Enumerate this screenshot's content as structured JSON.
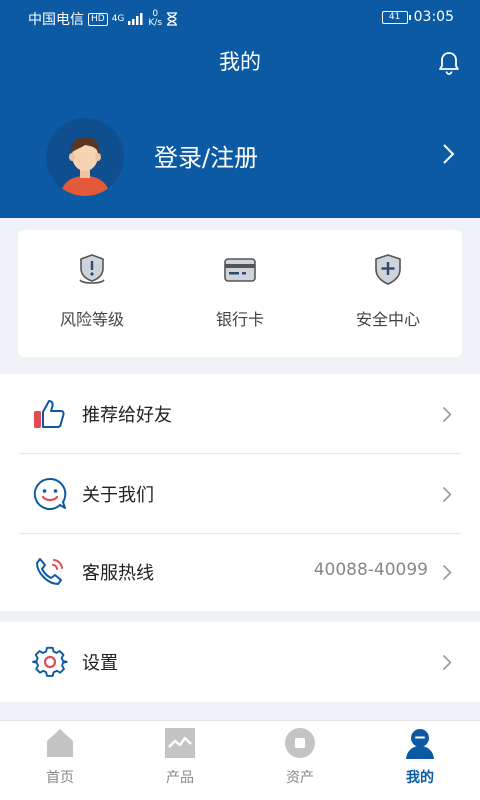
{
  "status_bar": {
    "carrier": "中国电信",
    "hd": "HD",
    "signal": "4G",
    "speed_value": "0",
    "speed_unit": "K/s",
    "battery": "41",
    "time": "03:05"
  },
  "header": {
    "title": "我的",
    "login_text": "登录/注册"
  },
  "quick_actions": [
    {
      "label": "风险等级",
      "icon": "shield-badge-icon"
    },
    {
      "label": "银行卡",
      "icon": "bank-card-icon"
    },
    {
      "label": "安全中心",
      "icon": "shield-plus-icon"
    }
  ],
  "menu": [
    {
      "label": "推荐给好友",
      "icon": "thumbs-up-icon",
      "value": ""
    },
    {
      "label": "关于我们",
      "icon": "smiley-chat-icon",
      "value": ""
    },
    {
      "label": "客服热线",
      "icon": "phone-icon",
      "value": "40088-40099"
    }
  ],
  "settings": {
    "label": "设置",
    "icon": "gear-icon"
  },
  "bottom_nav": [
    {
      "label": "首页",
      "icon": "home-icon",
      "active": false
    },
    {
      "label": "产品",
      "icon": "chart-icon",
      "active": false
    },
    {
      "label": "资产",
      "icon": "asset-icon",
      "active": false
    },
    {
      "label": "我的",
      "icon": "user-icon",
      "active": true
    }
  ],
  "colors": {
    "brand_blue": "#0b5aa3",
    "accent_red": "#e04b55",
    "nav_gray": "#c4c4c4"
  }
}
